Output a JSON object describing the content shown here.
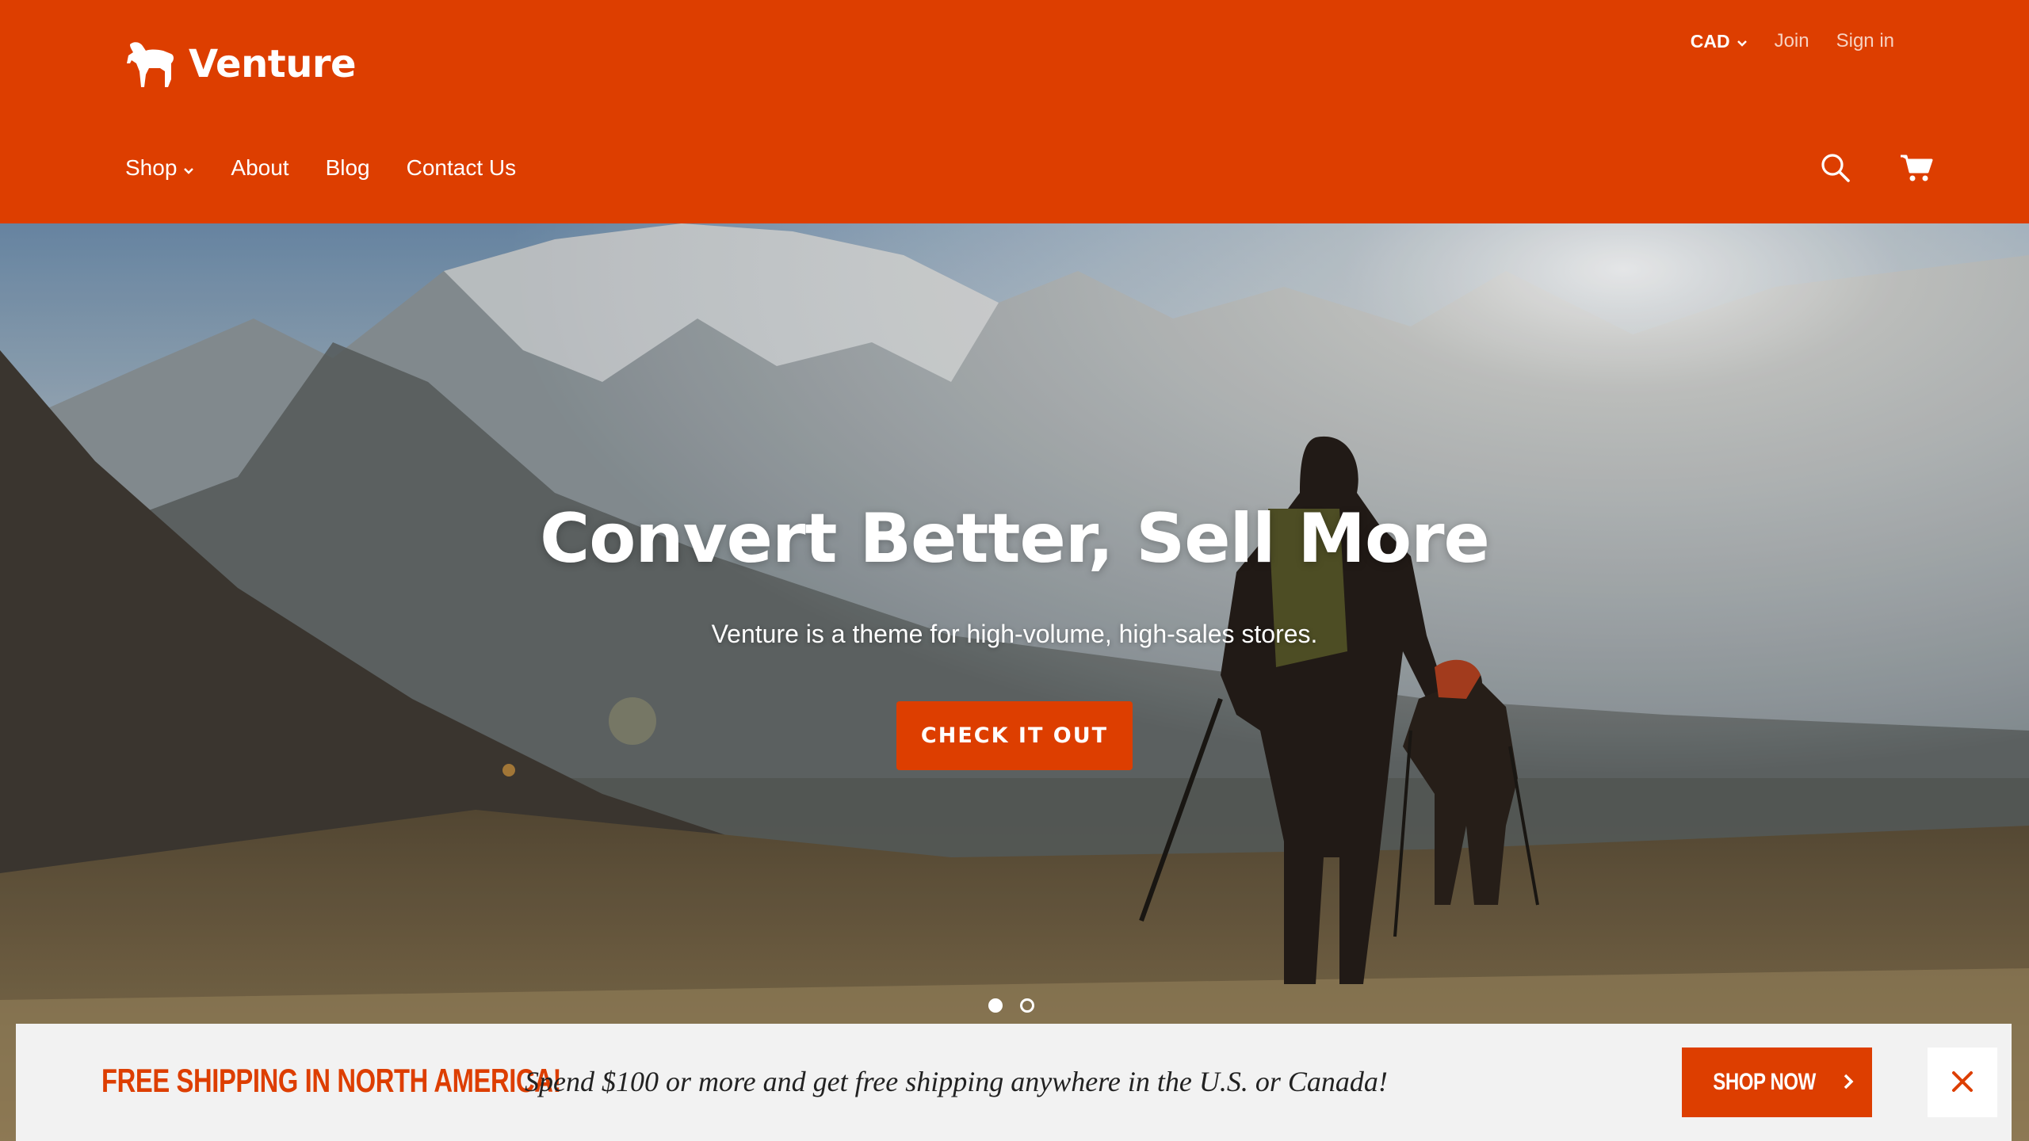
{
  "brand": {
    "name": "Venture",
    "logo_icon": "goat-logo-icon"
  },
  "topbar": {
    "currency": "CAD",
    "join": "Join",
    "sign_in": "Sign in"
  },
  "nav": {
    "items": [
      "Shop",
      "About",
      "Blog",
      "Contact Us"
    ]
  },
  "header_icons": [
    "search-icon",
    "cart-icon"
  ],
  "hero": {
    "title": "Convert Better, Sell More",
    "subtitle": "Venture is a theme for high-volume, high-sales stores.",
    "cta": "CHECK IT OUT",
    "slides": 2,
    "active_slide": 1
  },
  "promo": {
    "heading": "FREE SHIPPING IN NORTH AMERICA!",
    "text": "Spend $100 or more and get free shipping anywhere in the U.S. or Canada!",
    "button": "SHOP NOW"
  },
  "colors": {
    "accent": "#dd3e00",
    "promo_bg": "#f2f2f2"
  }
}
